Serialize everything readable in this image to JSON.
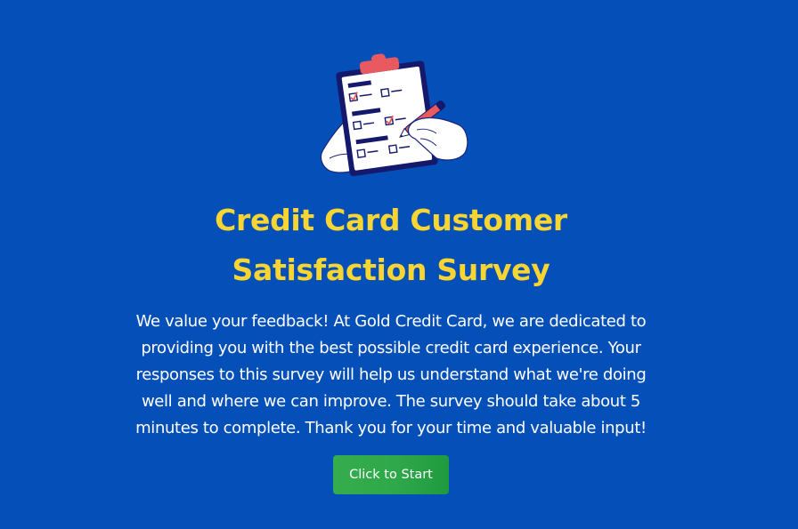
{
  "survey": {
    "title": "Credit Card Customer Satisfaction Survey",
    "intro": "We value your feedback! At Gold Credit Card, we are dedicated to providing you with the best possible credit card experience. Your responses to this survey will help us understand what we're doing well and where we can improve. The survey should take about 5 minutes to complete. Thank you for your time and valuable input!",
    "start_label": "Click to Start"
  },
  "illustration": {
    "icon": "clipboard-checklist-icon"
  },
  "colors": {
    "background": "#0550b8",
    "title": "#f9d532",
    "text": "#ffffff",
    "button": "#2ea84a"
  }
}
